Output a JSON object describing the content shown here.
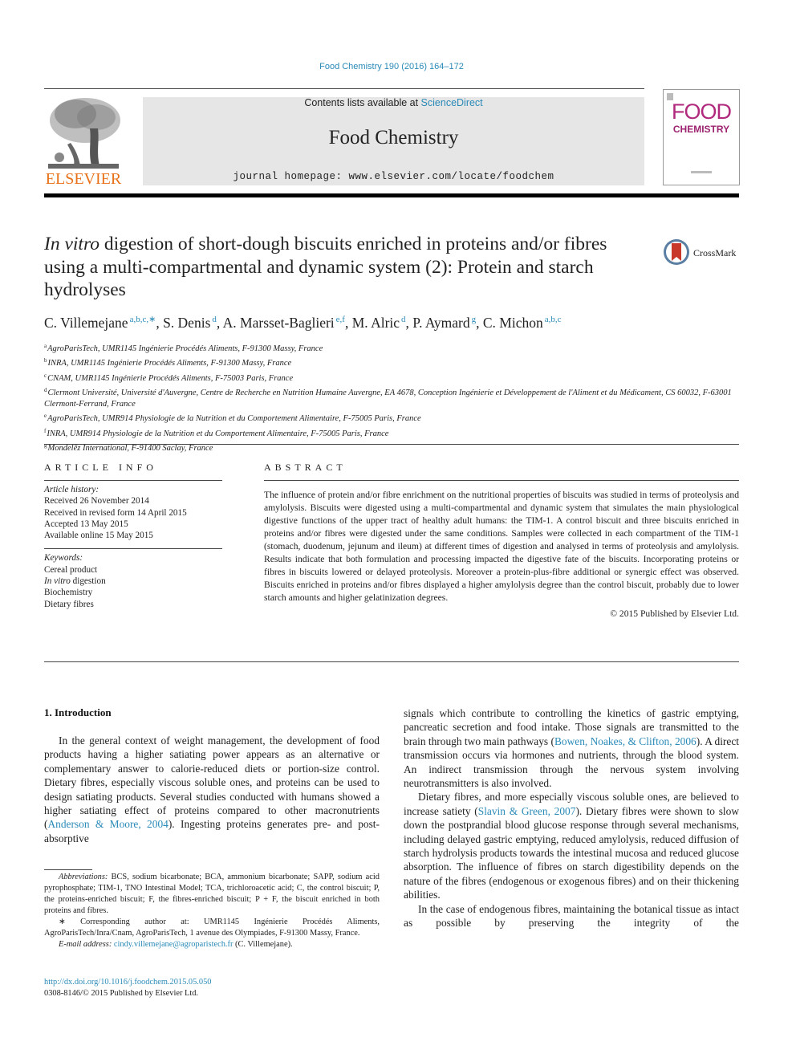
{
  "header": {
    "citation": "Food Chemistry 190 (2016) 164–172",
    "contents_prefix": "Contents lists available at ",
    "contents_link": "ScienceDirect",
    "journal_name": "Food Chemistry",
    "homepage": "journal homepage: www.elsevier.com/locate/foodchem",
    "publisher_logo_text": "ELSEVIER",
    "cover_title_top": "FOOD",
    "cover_title_bottom": "CHEMISTRY"
  },
  "article": {
    "title_italic": "In vitro",
    "title_rest": " digestion of short-dough biscuits enriched in proteins and/or fibres using a multi-compartmental and dynamic system (2): Protein and starch hydrolyses",
    "crossmark_label": "CrossMark",
    "authors": [
      {
        "name": "C. Villemejane",
        "sup": "a,b,c,∗",
        "sep": ", "
      },
      {
        "name": "S. Denis",
        "sup": "d",
        "sep": ", "
      },
      {
        "name": "A. Marsset-Baglieri",
        "sup": "e,f",
        "sep": ", "
      },
      {
        "name": "M. Alric",
        "sup": "d",
        "sep": ", "
      },
      {
        "name": "P. Aymard",
        "sup": "g",
        "sep": ", "
      },
      {
        "name": "C. Michon",
        "sup": "a,b,c",
        "sep": ""
      }
    ],
    "affiliations": [
      {
        "key": "a",
        "text": "AgroParisTech, UMR1145 Ingénierie Procédés Aliments, F-91300 Massy, France"
      },
      {
        "key": "b",
        "text": "INRA, UMR1145 Ingénierie Procédés Aliments, F-91300 Massy, France"
      },
      {
        "key": "c",
        "text": "CNAM, UMR1145 Ingénierie Procédés Aliments, F-75003 Paris, France"
      },
      {
        "key": "d",
        "text": "Clermont Université, Université d'Auvergne, Centre de Recherche en Nutrition Humaine Auvergne, EA 4678, Conception Ingénierie et Développement de l'Aliment et du Médicament, CS 60032, F-63001 Clermont-Ferrand, France"
      },
      {
        "key": "e",
        "text": "AgroParisTech, UMR914 Physiologie de la Nutrition et du Comportement Alimentaire, F-75005 Paris, France"
      },
      {
        "key": "f",
        "text": "INRA, UMR914 Physiologie de la Nutrition et du Comportement Alimentaire, F-75005 Paris, France"
      },
      {
        "key": "g",
        "text": "Mondelēz International, F-91400 Saclay, France"
      }
    ]
  },
  "article_info": {
    "heading": "ARTICLE INFO",
    "history_label": "Article history:",
    "history": [
      "Received 26 November 2014",
      "Received in revised form 14 April 2015",
      "Accepted 13 May 2015",
      "Available online 15 May 2015"
    ],
    "keywords_label": "Keywords:",
    "keywords": [
      {
        "italic": "",
        "text": "Cereal product"
      },
      {
        "italic": "In vitro",
        "text": " digestion"
      },
      {
        "italic": "",
        "text": "Biochemistry"
      },
      {
        "italic": "",
        "text": "Dietary fibres"
      }
    ]
  },
  "abstract": {
    "heading": "ABSTRACT",
    "text": "The influence of protein and/or fibre enrichment on the nutritional properties of biscuits was studied in terms of proteolysis and amylolysis. Biscuits were digested using a multi-compartmental and dynamic system that simulates the main physiological digestive functions of the upper tract of healthy adult humans: the TIM-1. A control biscuit and three biscuits enriched in proteins and/or fibres were digested under the same conditions. Samples were collected in each compartment of the TIM-1 (stomach, duodenum, jejunum and ileum) at different times of digestion and analysed in terms of proteolysis and amylolysis. Results indicate that both formulation and processing impacted the digestive fate of the biscuits. Incorporating proteins or fibres in biscuits lowered or delayed proteolysis. Moreover a protein-plus-fibre additional or synergic effect was observed. Biscuits enriched in proteins and/or fibres displayed a higher amylolysis degree than the control biscuit, probably due to lower starch amounts and higher gelatinization degrees.",
    "copyright": "© 2015 Published by Elsevier Ltd."
  },
  "intro": {
    "heading": "1. Introduction",
    "p1_before": "In the general context of weight management, the development of food products having a higher satiating power appears as an alternative or complementary answer to calorie-reduced diets or portion-size control. Dietary fibres, especially viscous soluble ones, and proteins can be used to design satiating products. Several studies conducted with humans showed a higher satiating effect of proteins compared to other macronutrients (",
    "p1_ref": "Anderson & Moore, 2004",
    "p1_after": "). Ingesting proteins generates pre- and post-absorptive",
    "r1_before": "signals which contribute to controlling the kinetics of gastric emptying, pancreatic secretion and food intake. Those signals are transmitted to the brain through two main pathways (",
    "r1_ref": "Bowen, Noakes, & Clifton, 2006",
    "r1_after": "). A direct transmission occurs via hormones and nutrients, through the blood system. An indirect transmission through the nervous system involving neurotransmitters is also involved.",
    "p2_before": "Dietary fibres, and more especially viscous soluble ones, are believed to increase satiety (",
    "p2_ref": "Slavin & Green, 2007",
    "p2_after": "). Dietary fibres were shown to slow down the postprandial blood glucose response through several mechanisms, including delayed gastric emptying, reduced amylolysis, reduced diffusion of starch hydrolysis products towards the intestinal mucosa and reduced glucose absorption. The influence of fibres on starch digestibility depends on the nature of the fibres (endogenous or exogenous fibres) and on their thickening abilities.",
    "p3": "In the case of endogenous fibres, maintaining the botanical tissue as intact as possible by preserving the integrity of the"
  },
  "footnotes": {
    "abbrev_label": "Abbreviations:",
    "abbrev_text": " BCS, sodium bicarbonate; BCA, ammonium bicarbonate; SAPP, sodium acid pyrophosphate; TIM-1, TNO Intestinal Model; TCA, trichloroacetic acid; C, the control biscuit; P, the proteins-enriched biscuit; F, the fibres-enriched biscuit; P + F, the biscuit enriched in both proteins and fibres.",
    "corresponding": "∗ Corresponding author at: UMR1145 Ingénierie Procédés Aliments, AgroParisTech/Inra/Cnam, AgroParisTech, 1 avenue des Olympiades, F-91300 Massy, France.",
    "email_label": "E-mail address:",
    "email": "cindy.villemejane@agroparistech.fr",
    "email_suffix": " (C. Villemejane).",
    "doi": "http://dx.doi.org/10.1016/j.foodchem.2015.05.050",
    "issn": "0308-8146/© 2015 Published by Elsevier Ltd."
  }
}
